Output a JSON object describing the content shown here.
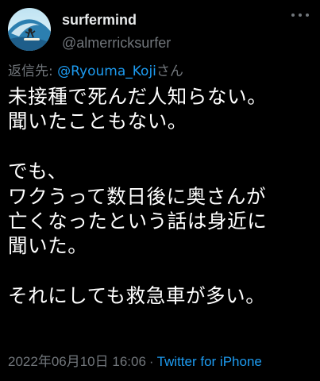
{
  "user": {
    "display_name": "surfermind",
    "handle": "@almerricksurfer"
  },
  "reply": {
    "prefix": "返信先: ",
    "mention": "@Ryouma_Koji",
    "suffix": "さん"
  },
  "tweet": {
    "text": "未接種で死んだ人知らない。\n聞いたこともない。\n\nでも、\nワクうって数日後に奥さんが\n亡くなったという話は身近に\n聞いた。\n\nそれにしても救急車が多い。"
  },
  "meta": {
    "timestamp": "2022年06月10日 16:06",
    "separator": "·",
    "source": "Twitter for iPhone"
  },
  "icons": {
    "avatar": "surfer-avatar",
    "more": "more-options-icon"
  }
}
